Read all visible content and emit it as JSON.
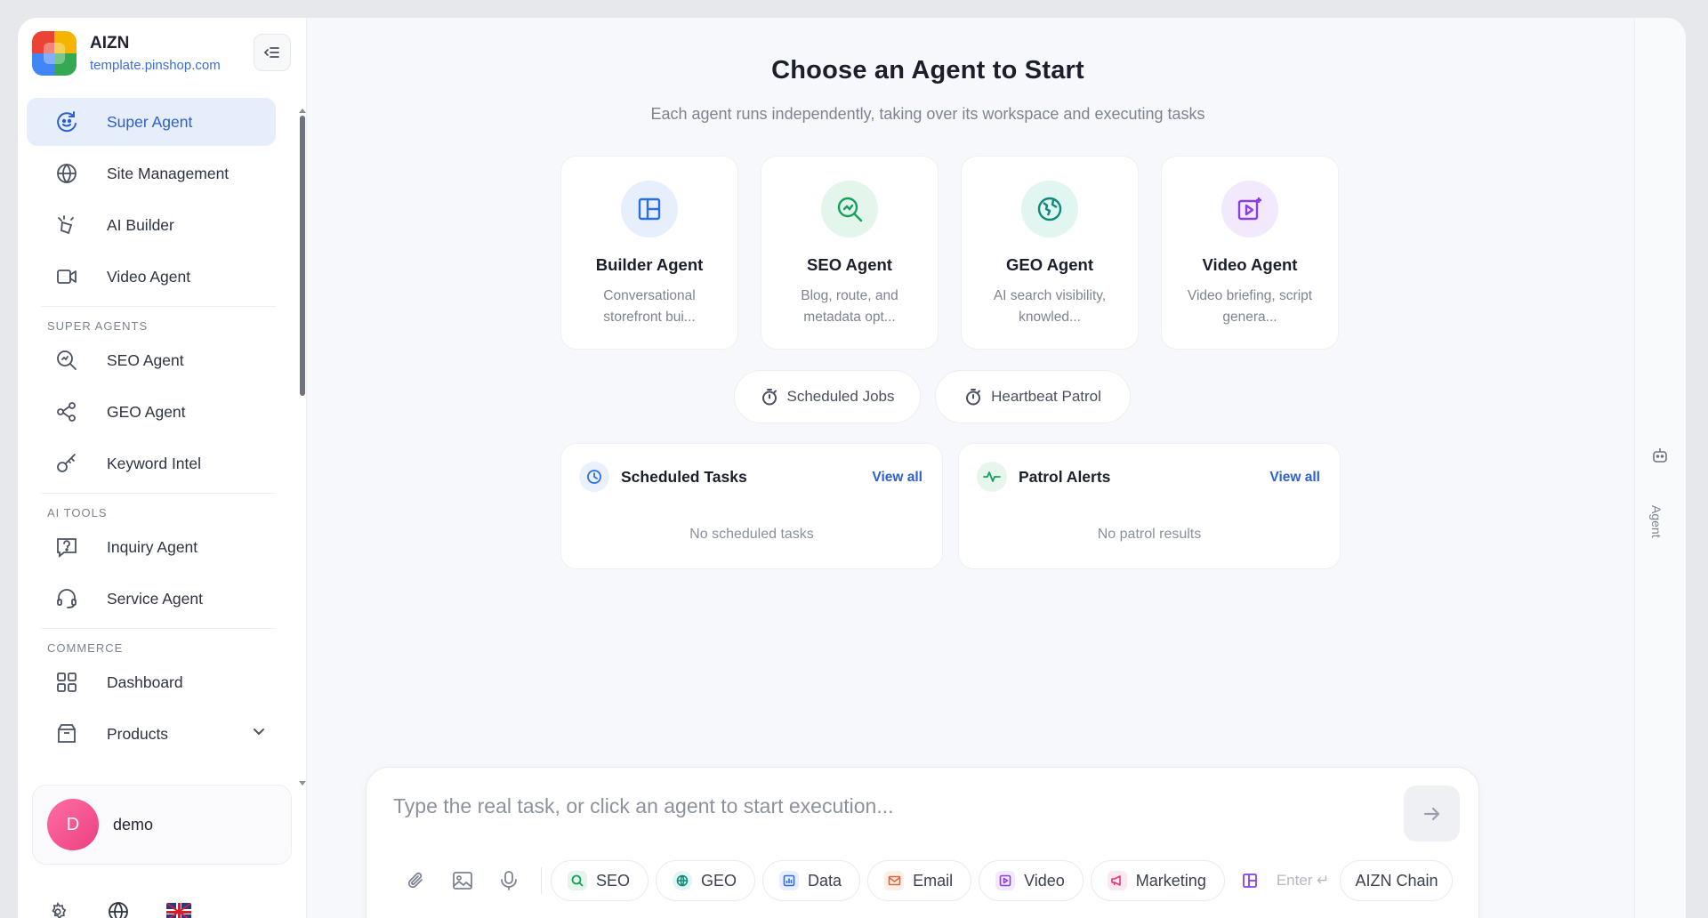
{
  "brand": {
    "name": "AIZN",
    "url": "template.pinshop.com"
  },
  "sidebar": {
    "top_items": [
      {
        "label": "Super Agent",
        "icon": "super-agent-icon",
        "active": true
      },
      {
        "label": "Site Management",
        "icon": "globe-icon"
      },
      {
        "label": "AI Builder",
        "icon": "ai-builder-icon"
      },
      {
        "label": "Video Agent",
        "icon": "video-camera-icon"
      }
    ],
    "sections": [
      {
        "title": "SUPER AGENTS",
        "items": [
          {
            "label": "SEO Agent",
            "icon": "search-icon"
          },
          {
            "label": "GEO Agent",
            "icon": "share-nodes-icon"
          },
          {
            "label": "Keyword Intel",
            "icon": "key-icon"
          }
        ]
      },
      {
        "title": "AI TOOLS",
        "items": [
          {
            "label": "Inquiry Agent",
            "icon": "inquiry-icon"
          },
          {
            "label": "Service Agent",
            "icon": "headset-icon"
          }
        ]
      },
      {
        "title": "COMMERCE",
        "items": [
          {
            "label": "Dashboard",
            "icon": "dashboard-icon"
          },
          {
            "label": "Products",
            "icon": "products-icon"
          }
        ]
      }
    ],
    "user": {
      "initial": "D",
      "name": "demo"
    }
  },
  "main": {
    "title": "Choose an Agent to Start",
    "subtitle": "Each agent runs independently, taking over its workspace and executing tasks",
    "agents": [
      {
        "name": "Builder Agent",
        "desc": "Conversational storefront bui...",
        "icon": "layout-icon",
        "color": "#2c6fe0",
        "bg": "#e7effc"
      },
      {
        "name": "SEO Agent",
        "desc": "Blog, route, and metadata opt...",
        "icon": "search-chart-icon",
        "color": "#16a05a",
        "bg": "#e4f6ec"
      },
      {
        "name": "GEO Agent",
        "desc": "AI search visibility, knowled...",
        "icon": "globe-icon",
        "color": "#0d8a78",
        "bg": "#e1f5f1"
      },
      {
        "name": "Video Agent",
        "desc": "Video briefing, script genera...",
        "icon": "video-sparkle-icon",
        "color": "#8b3fe0",
        "bg": "#f2eafc"
      }
    ],
    "pills": [
      {
        "label": "Scheduled Jobs",
        "icon": "stopwatch-icon"
      },
      {
        "label": "Heartbeat Patrol",
        "icon": "stopwatch-icon"
      }
    ],
    "panels": [
      {
        "title": "Scheduled Tasks",
        "link": "View all",
        "empty": "No scheduled tasks",
        "icon": "clock-icon",
        "color": "#2c6fe0",
        "bg": "#eaf0fc"
      },
      {
        "title": "Patrol Alerts",
        "link": "View all",
        "empty": "No patrol results",
        "icon": "pulse-icon",
        "color": "#16a05a",
        "bg": "#e6f6ed"
      }
    ]
  },
  "composer": {
    "placeholder": "Type the real task, or click an agent to start execution...",
    "chips": [
      {
        "label": "SEO",
        "color": "#16a05a",
        "bg": "#e4f6ec"
      },
      {
        "label": "GEO",
        "color": "#0d8a78",
        "bg": "#e1f5f1"
      },
      {
        "label": "Data",
        "color": "#2c6fe0",
        "bg": "#e7effc"
      },
      {
        "label": "Email",
        "color": "#e0643a",
        "bg": "#fdeee6"
      },
      {
        "label": "Video",
        "color": "#8b3fe0",
        "bg": "#f2eafc"
      },
      {
        "label": "Marketing",
        "color": "#e03a78",
        "bg": "#fde8f0"
      }
    ],
    "enter_hint": "Enter ↵",
    "chain_label": "AIZN Chain"
  },
  "right_rail": {
    "label": "Agent"
  }
}
